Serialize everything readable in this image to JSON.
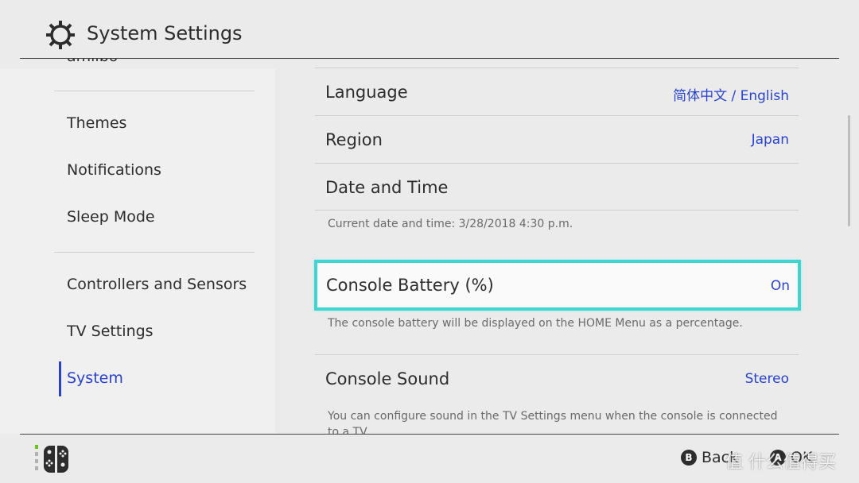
{
  "header": {
    "title": "System Settings",
    "icon": "gear-icon"
  },
  "sidebar": {
    "items": [
      {
        "label": "amiibo"
      },
      {
        "label": "Themes"
      },
      {
        "label": "Notifications"
      },
      {
        "label": "Sleep Mode"
      },
      {
        "label": "Controllers and Sensors"
      },
      {
        "label": "TV Settings"
      },
      {
        "label": "System",
        "selected": true
      }
    ]
  },
  "main": {
    "language": {
      "label": "Language",
      "value": "简体中文 / English"
    },
    "region": {
      "label": "Region",
      "value": "Japan"
    },
    "datetime": {
      "label": "Date and Time",
      "desc": "Current date and time: 3/28/2018 4:30 p.m."
    },
    "battery": {
      "label": "Console Battery (%)",
      "value": "On",
      "desc": "The console battery will be displayed on the HOME Menu as a percentage."
    },
    "sound": {
      "label": "Console Sound",
      "value": "Stereo",
      "desc": "You can configure sound in the TV Settings menu when the console is connected to a TV."
    }
  },
  "footer": {
    "back_key": "B",
    "back_label": "Back",
    "ok_key": "A",
    "ok_label": "OK",
    "watermark": "值 什么值得买"
  },
  "colors": {
    "accent": "#2a43cf",
    "focus": "#3fd6d2",
    "background": "#ebebeb"
  }
}
